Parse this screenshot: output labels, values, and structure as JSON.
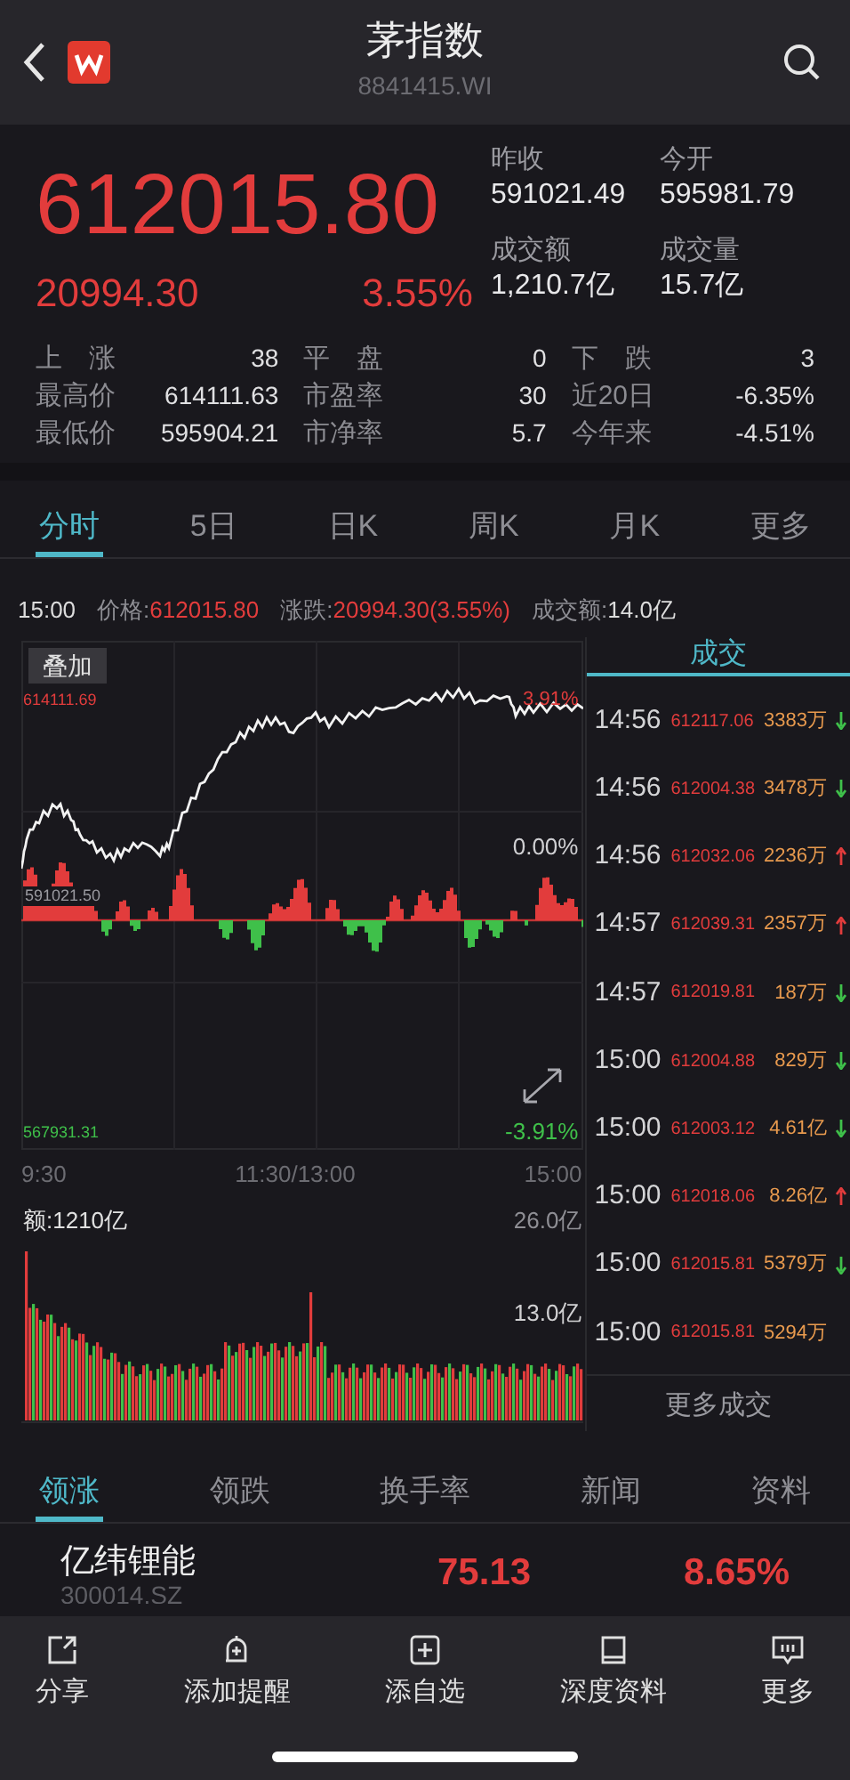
{
  "header": {
    "title": "茅指数",
    "code": "8841415.WI"
  },
  "quote": {
    "price": "612015.80",
    "change": "20994.30",
    "change_pct": "3.55%",
    "stats": [
      {
        "label": "昨收",
        "value": "591021.49"
      },
      {
        "label": "今开",
        "value": "595981.79"
      },
      {
        "label": "成交额",
        "value": "1,210.7亿"
      },
      {
        "label": "成交量",
        "value": "15.7亿"
      }
    ],
    "grid": [
      {
        "label": "上　涨",
        "value": "38"
      },
      {
        "label": "平　盘",
        "value": "0"
      },
      {
        "label": "下　跌",
        "value": "3"
      },
      {
        "label": "最高价",
        "value": "614111.63"
      },
      {
        "label": "市盈率",
        "value": "30"
      },
      {
        "label": "近20日",
        "value": "-6.35%"
      },
      {
        "label": "最低价",
        "value": "595904.21"
      },
      {
        "label": "市净率",
        "value": "5.7"
      },
      {
        "label": "今年来",
        "value": "-4.51%"
      }
    ]
  },
  "chart_tabs": [
    {
      "label": "分时",
      "selected": true
    },
    {
      "label": "5日",
      "selected": false
    },
    {
      "label": "日K",
      "selected": false
    },
    {
      "label": "周K",
      "selected": false
    },
    {
      "label": "月K",
      "selected": false
    },
    {
      "label": "更多",
      "selected": false
    }
  ],
  "info": {
    "time": "15:00",
    "price_label": "价格:",
    "price": "612015.80",
    "change_label": "涨跌:",
    "change": "20994.30(3.55%)",
    "amount_label": "成交额:",
    "amount": "14.0亿"
  },
  "chart": {
    "overlay_button": "叠加",
    "high": "614111.69",
    "base": "591021.50",
    "low": "567931.31",
    "high_pct": "3.91%",
    "base_pct": "0.00%",
    "low_pct": "-3.91%",
    "times": [
      "9:30",
      "11:30/13:00",
      "15:00"
    ],
    "volume_label": "额:1210亿",
    "volume_max": "26.0亿",
    "volume_mid": "13.0亿"
  },
  "trades": {
    "title": "成交",
    "more": "更多成交",
    "rows": [
      {
        "time": "14:56",
        "price": "612117.06",
        "volume": "3383万",
        "kind": "down"
      },
      {
        "time": "14:56",
        "price": "612004.38",
        "volume": "3478万",
        "kind": "down"
      },
      {
        "time": "14:56",
        "price": "612032.06",
        "volume": "2236万",
        "kind": "up"
      },
      {
        "time": "14:57",
        "price": "612039.31",
        "volume": "2357万",
        "kind": "up"
      },
      {
        "time": "14:57",
        "price": "612019.81",
        "volume": "187万",
        "kind": "down"
      },
      {
        "time": "15:00",
        "price": "612004.88",
        "volume": "829万",
        "kind": "down"
      },
      {
        "time": "15:00",
        "price": "612003.12",
        "volume": "4.61亿",
        "kind": "down"
      },
      {
        "time": "15:00",
        "price": "612018.06",
        "volume": "8.26亿",
        "kind": "up"
      },
      {
        "time": "15:00",
        "price": "612015.81",
        "volume": "5379万",
        "kind": "down"
      },
      {
        "time": "15:00",
        "price": "612015.81",
        "volume": "5294万",
        "kind": "plain"
      }
    ]
  },
  "list_tabs": [
    {
      "label": "领涨",
      "selected": true
    },
    {
      "label": "领跌",
      "selected": false
    },
    {
      "label": "换手率",
      "selected": false
    },
    {
      "label": "新闻",
      "selected": false
    },
    {
      "label": "资料",
      "selected": false
    }
  ],
  "stock": {
    "name": "亿纬锂能",
    "code": "300014.SZ",
    "price": "75.13",
    "change_pct": "8.65%"
  },
  "toolbar": [
    {
      "kind": "share",
      "label": "分享"
    },
    {
      "kind": "alert",
      "label": "添加提醒"
    },
    {
      "kind": "add",
      "label": "添自选"
    },
    {
      "kind": "book",
      "label": "深度资料"
    },
    {
      "kind": "more",
      "label": "更多"
    }
  ]
}
